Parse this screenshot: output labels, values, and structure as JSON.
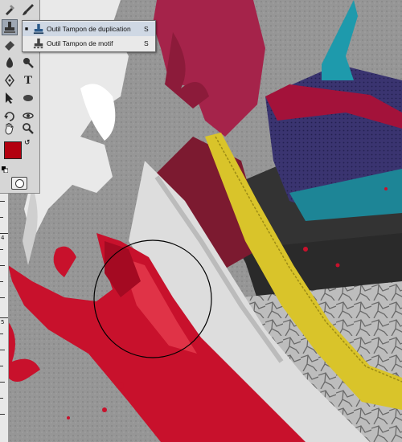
{
  "tools_panel": {
    "tools": [
      {
        "name": "spot-healing-brush-tool",
        "glyph": "✚"
      },
      {
        "name": "brush-tool",
        "glyph": "✎"
      },
      {
        "name": "clone-stamp-tool",
        "glyph": "⛏"
      },
      {
        "name": "history-brush-tool",
        "glyph": "✍"
      },
      {
        "name": "eraser-tool",
        "glyph": "▭"
      },
      {
        "name": "gradient-tool",
        "glyph": "▦"
      },
      {
        "name": "blur-tool",
        "glyph": "💧"
      },
      {
        "name": "dodge-tool",
        "glyph": "🔍"
      },
      {
        "name": "pen-tool",
        "glyph": "✒"
      },
      {
        "name": "type-tool",
        "glyph": "T"
      },
      {
        "name": "path-selection-tool",
        "glyph": "➤"
      },
      {
        "name": "ellipse-tool",
        "glyph": "⬭"
      },
      {
        "name": "3d-rotate-tool",
        "glyph": "⟲"
      },
      {
        "name": "3d-orbit-tool",
        "glyph": "⟳"
      },
      {
        "name": "hand-tool",
        "glyph": "✋"
      },
      {
        "name": "zoom-tool",
        "glyph": "🔍"
      }
    ],
    "foreground_color": "#b3000f",
    "background_color": "#ffffff"
  },
  "flyout": {
    "items": [
      {
        "bullet": "■",
        "label": "Outil Tampon de duplication",
        "shortcut": "S"
      },
      {
        "bullet": "",
        "label": "Outil Tampon de motif",
        "shortcut": "S"
      }
    ]
  },
  "ruler": {
    "labels": [
      "4",
      "5"
    ]
  }
}
